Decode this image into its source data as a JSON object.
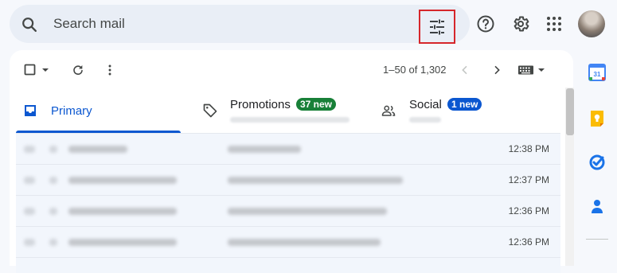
{
  "search": {
    "placeholder": "Search mail"
  },
  "pagination": {
    "range": "1–50 of 1,302"
  },
  "tabs": [
    {
      "label": "Primary",
      "active": true
    },
    {
      "label": "Promotions",
      "badge": "37 new",
      "badge_color": "#188038"
    },
    {
      "label": "Social",
      "badge": "1 new",
      "badge_color": "#0b57d0"
    }
  ],
  "emails": [
    {
      "time": "12:38 PM"
    },
    {
      "time": "12:37 PM"
    },
    {
      "time": "12:36 PM"
    },
    {
      "time": "12:36 PM"
    }
  ],
  "icons": {
    "search": "search-icon",
    "filter": "tune-icon",
    "help": "help-icon",
    "settings": "gear-icon",
    "apps": "apps-grid-icon",
    "select": "checkbox-icon",
    "refresh": "refresh-icon",
    "more": "more-vert-icon",
    "prev": "chevron-left-icon",
    "next": "chevron-right-icon",
    "keyboard": "keyboard-icon",
    "calendar": "calendar-icon",
    "keep": "keep-icon",
    "tasks": "tasks-icon",
    "contacts": "contacts-icon"
  },
  "colors": {
    "accent": "#0b57d0",
    "highlight_border": "#d6262b"
  }
}
